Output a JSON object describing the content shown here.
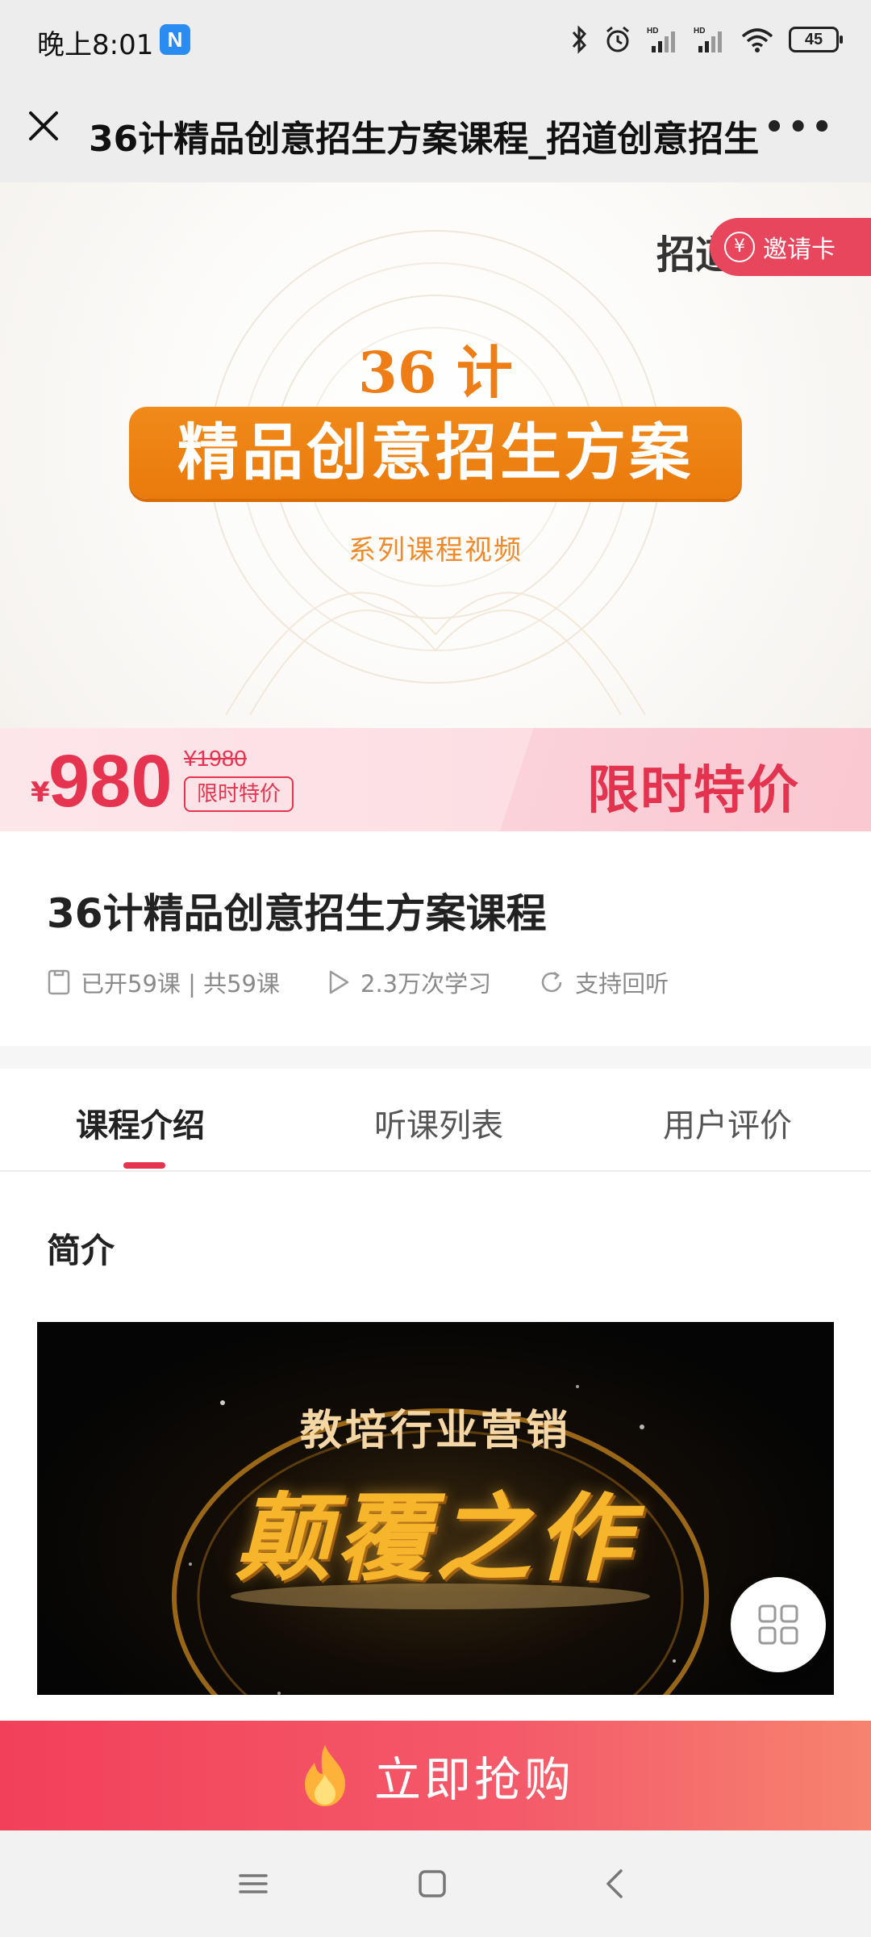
{
  "status_bar": {
    "time": "晚上8:01",
    "app_badge": "N",
    "battery": "45"
  },
  "title_bar": {
    "title": "36计精品创意招生方案课程_招道创意招生",
    "more": "•••"
  },
  "hero": {
    "logo_text": "招道",
    "invite_label": "邀请卡",
    "invite_coin": "¥",
    "headline_small": "36 计",
    "headline_banner": "精品创意招生方案",
    "subtitle": "系列课程视频"
  },
  "price": {
    "currency": "¥",
    "current": "980",
    "original": "¥1980",
    "tag": "限时特价",
    "promo_label": "限时特价"
  },
  "course": {
    "title": "36计精品创意招生方案课程",
    "lessons": "已开59课 | 共59课",
    "learners": "2.3万次学习",
    "replay": "支持回听"
  },
  "tabs": [
    {
      "label": "课程介绍",
      "active": true
    },
    {
      "label": "听课列表",
      "active": false
    },
    {
      "label": "用户评价",
      "active": false
    }
  ],
  "intro": {
    "section_title": "简介",
    "image_top_text": "教培行业营销",
    "image_big_text": "颠覆之作"
  },
  "buy_button": {
    "label": "立即抢购"
  },
  "colors": {
    "accent": "#e63450",
    "orange": "#ef7d16"
  }
}
